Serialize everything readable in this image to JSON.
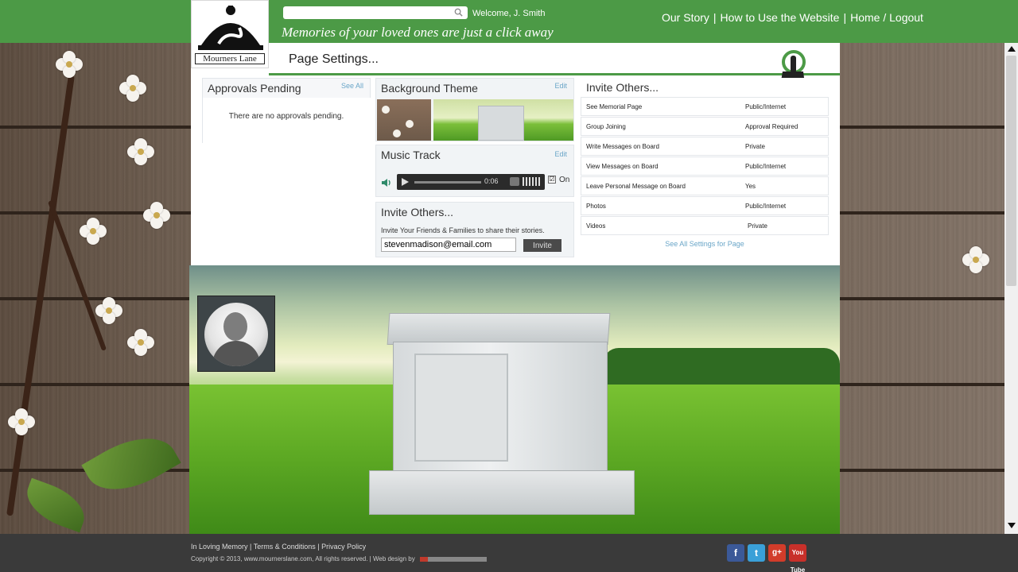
{
  "header": {
    "logo_text": "Mourners Lane",
    "search_placeholder": "",
    "welcome": "Welcome,  J. Smith",
    "tagline": "Memories of your loved ones are just a click away",
    "nav": [
      "Our Story",
      "How to Use the Website",
      "Home / Logout"
    ],
    "nav_separator": "|"
  },
  "settings": {
    "title": "Page Settings...",
    "approvals": {
      "title": "Approvals Pending",
      "link": "See All",
      "message": "There are no approvals pending."
    },
    "background_theme": {
      "title": "Background Theme",
      "link": "Edit"
    },
    "music_track": {
      "title": "Music Track",
      "link": "Edit",
      "time": "0:06",
      "on_check": "☑",
      "on_label": "On"
    },
    "invite_box": {
      "title": "Invite Others...",
      "subtitle": "Invite Your Friends & Families to share their stories.",
      "email_value": "stevenmadison@email.com",
      "button": "Invite"
    },
    "permissions": {
      "title": "Invite Others...",
      "rows": [
        {
          "key": "See Memorial Page",
          "value": "Public/Internet"
        },
        {
          "key": "Group Joining",
          "value": "Approval Required"
        },
        {
          "key": "Write Messages on Board",
          "value": "Private"
        },
        {
          "key": "View Messages on Board",
          "value": "Public/Internet"
        },
        {
          "key": "Leave Personal Message on Board",
          "value": "Yes"
        },
        {
          "key": "Photos",
          "value": "Public/Internet"
        },
        {
          "key": "Videos",
          "value": "Private"
        }
      ],
      "see_all": "See All Settings for Page"
    }
  },
  "footer": {
    "links": [
      "In Loving Memory",
      "Terms & Conditions",
      "Privacy Policy"
    ],
    "link_separator": "|",
    "copyright": "Copyright © 2013, www.mournerslane.com, All rights reserved.  | Web design by",
    "social": [
      "f",
      "t",
      "g+",
      "You Tube"
    ]
  },
  "colors": {
    "brand_green": "#4c9a46",
    "link_blue": "#6aa6c8",
    "footer_bg": "#3a3a3a"
  },
  "icons": [
    "search-icon",
    "pointing-hand-icon",
    "speaker-icon",
    "play-icon",
    "facebook-icon",
    "twitter-icon",
    "google-plus-icon",
    "youtube-icon"
  ]
}
